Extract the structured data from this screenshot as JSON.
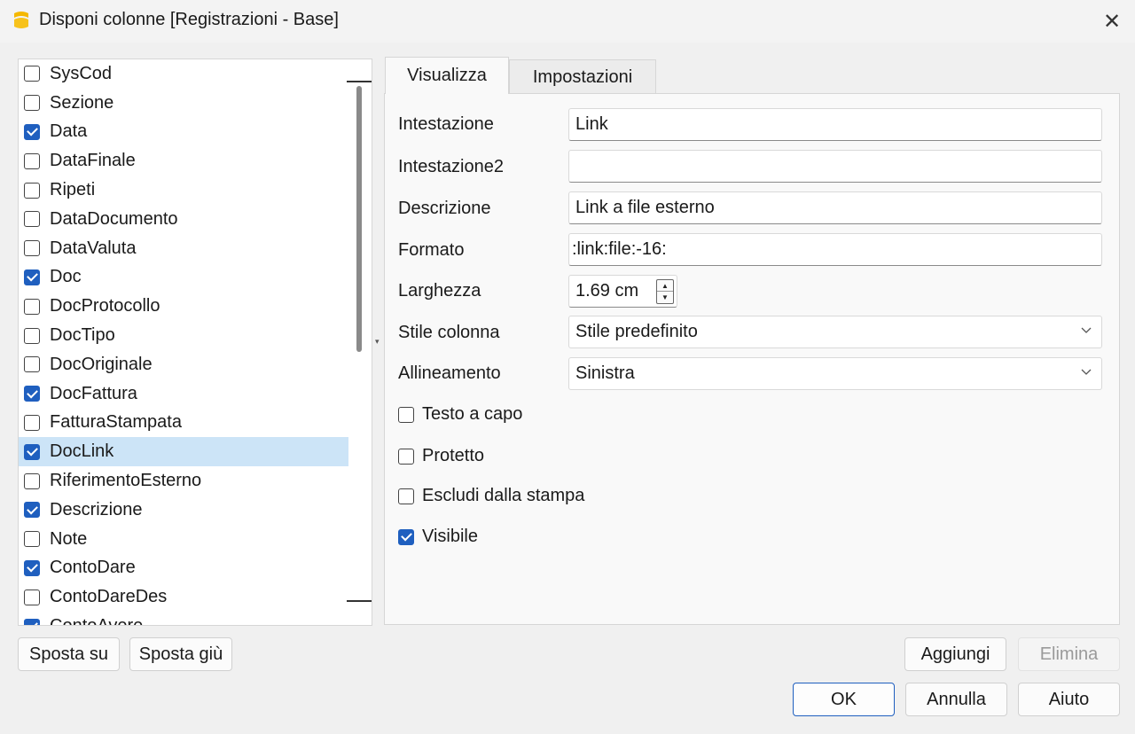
{
  "window": {
    "title": "Disponi colonne [Registrazioni - Base]",
    "close_symbol": "✕",
    "app_icon": "banana-app-icon",
    "accent_color": "#1f5fbf",
    "selection_color": "#cce4f7"
  },
  "columns_list": {
    "items": [
      {
        "label": "SysCod",
        "checked": false
      },
      {
        "label": "Sezione",
        "checked": false
      },
      {
        "label": "Data",
        "checked": true
      },
      {
        "label": "DataFinale",
        "checked": false
      },
      {
        "label": "Ripeti",
        "checked": false
      },
      {
        "label": "DataDocumento",
        "checked": false
      },
      {
        "label": "DataValuta",
        "checked": false
      },
      {
        "label": "Doc",
        "checked": true
      },
      {
        "label": "DocProtocollo",
        "checked": false
      },
      {
        "label": "DocTipo",
        "checked": false
      },
      {
        "label": "DocOriginale",
        "checked": false
      },
      {
        "label": "DocFattura",
        "checked": true
      },
      {
        "label": "FatturaStampata",
        "checked": false
      },
      {
        "label": "DocLink",
        "checked": true,
        "selected": true
      },
      {
        "label": "RiferimentoEsterno",
        "checked": false
      },
      {
        "label": "Descrizione",
        "checked": true
      },
      {
        "label": "Note",
        "checked": false
      },
      {
        "label": "ContoDare",
        "checked": true
      },
      {
        "label": "ContoDareDes",
        "checked": false
      },
      {
        "label": "ContoAvere",
        "checked": true
      }
    ]
  },
  "tabs": {
    "visualizza": "Visualizza",
    "impostazioni": "Impostazioni",
    "active": "visualizza"
  },
  "form": {
    "intestazione_label": "Intestazione",
    "intestazione_value": "Link",
    "intestazione2_label": "Intestazione2",
    "intestazione2_value": "",
    "descrizione_label": "Descrizione",
    "descrizione_value": "Link a file esterno",
    "formato_label": "Formato",
    "formato_value": ":link:file:-16:",
    "larghezza_label": "Larghezza",
    "larghezza_value": "1.69 cm",
    "stile_label": "Stile colonna",
    "stile_value": "Stile predefinito",
    "allineamento_label": "Allineamento",
    "allineamento_value": "Sinistra",
    "options": [
      {
        "label": "Testo a capo",
        "checked": false
      },
      {
        "label": "Protetto",
        "checked": false
      },
      {
        "label": "Escludi dalla stampa",
        "checked": false
      },
      {
        "label": "Visibile",
        "checked": true
      }
    ]
  },
  "buttons": {
    "sposta_su": "Sposta su",
    "sposta_giu": "Sposta giù",
    "aggiungi": "Aggiungi",
    "elimina": "Elimina",
    "ok": "OK",
    "annulla": "Annulla",
    "aiuto": "Aiuto"
  }
}
